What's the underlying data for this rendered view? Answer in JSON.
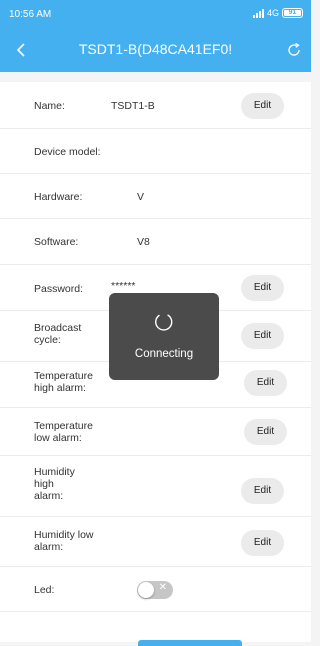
{
  "status_bar": {
    "time": "10:56 AM",
    "network": "4G",
    "battery": "91"
  },
  "nav": {
    "title": "TSDT1-B(D48CA41EF0!",
    "back_icon": "chevron-left-icon",
    "refresh_icon": "refresh-icon"
  },
  "rows": [
    {
      "label": "Name:",
      "value": "TSDT1-B",
      "edit": "Edit"
    },
    {
      "label": "Device model:",
      "value": ""
    },
    {
      "label": "Hardware:",
      "value": "V"
    },
    {
      "label": "Software:",
      "value": "V8"
    },
    {
      "label": "Password:",
      "value": "******",
      "edit": "Edit"
    },
    {
      "label": "Broadcast cycle:",
      "edit": "Edit"
    },
    {
      "label": "Temperature high alarm:",
      "edit": "Edit"
    },
    {
      "label": "Temperature low alarm:",
      "edit": "Edit"
    },
    {
      "label": "Humidity high alarm:",
      "edit": "Edit"
    },
    {
      "label": "Humidity low alarm:",
      "edit": "Edit"
    },
    {
      "label": "Led:",
      "toggle": false
    }
  ],
  "toast": {
    "text": "Connecting",
    "icon": "spinner-icon"
  },
  "colors": {
    "accent": "#45b0f0",
    "edit_button": "#ebebeb",
    "toast_bg": "#3c3c3c"
  }
}
